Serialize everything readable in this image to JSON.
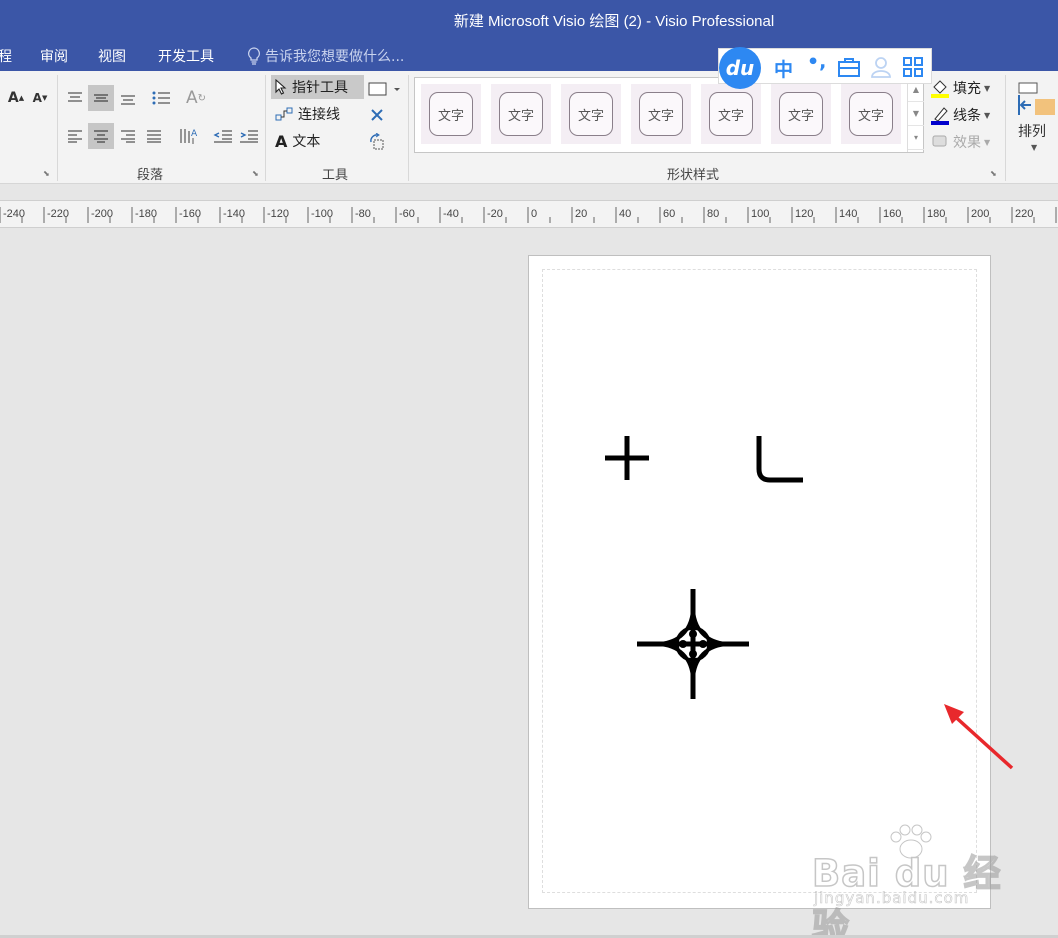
{
  "window": {
    "title": "新建 Microsoft Visio 绘图 (2) - Visio Professional"
  },
  "menu": {
    "items": [
      {
        "label": "程"
      },
      {
        "label": "审阅"
      },
      {
        "label": "视图"
      },
      {
        "label": "开发工具"
      }
    ],
    "tell_me": "告诉我您想要做什么..."
  },
  "ribbon": {
    "groups": {
      "paragraph": "段落",
      "tools": "工具",
      "shape_styles": "形状样式"
    },
    "tools": {
      "pointer": "指针工具",
      "connector": "连接线",
      "text": "文本"
    },
    "style_cells": [
      "文字",
      "文字",
      "文字",
      "文字",
      "文字",
      "文字",
      "文字"
    ],
    "fill": "填充",
    "line": "线条",
    "effects": "效果",
    "arrange": "排列",
    "colors": {
      "fill_swatch": "#ffff00",
      "line_swatch": "#0000cc"
    }
  },
  "ime_toolbar": {
    "logo": "du",
    "icons": [
      "中",
      "punctuation-icon",
      "toolbox-icon",
      "user-icon",
      "grid-icon"
    ]
  },
  "ruler": {
    "ticks": [
      "-240",
      "-220",
      "-200",
      "-180",
      "-160",
      "-140",
      "-120",
      "-100",
      "-80",
      "-60",
      "-40",
      "-20",
      "0",
      "20",
      "40",
      "60",
      "80",
      "100",
      "120",
      "140",
      "160",
      "180",
      "200",
      "220"
    ]
  },
  "canvas": {
    "shapes": [
      "cross-shape",
      "corner-shape",
      "interchange-shape"
    ],
    "annotation": "red-arrow"
  },
  "watermark": {
    "text": "Bai du 经验",
    "sub": "jingyan.baidu.com"
  },
  "theme": {
    "title_bar": "#3b56a7",
    "accent_blue": "#2d88f2",
    "arrow_red": "#e8282c"
  }
}
